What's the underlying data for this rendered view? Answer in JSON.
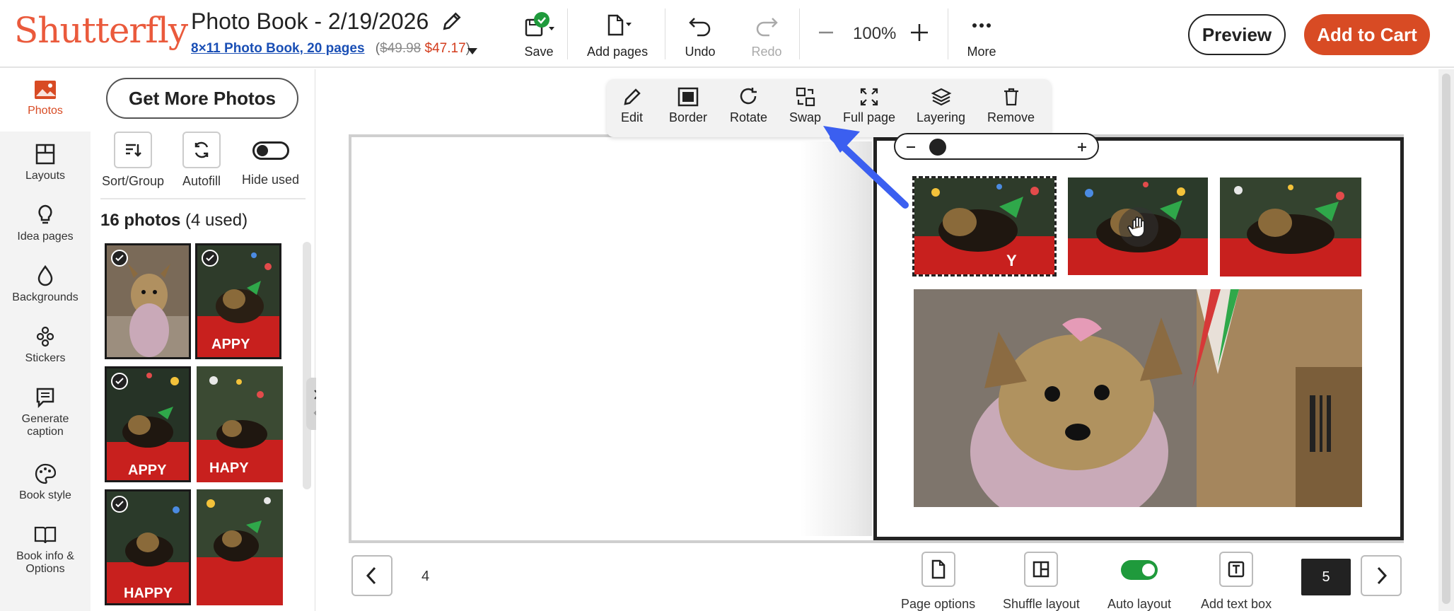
{
  "brand": {
    "logo": "Shutterfly"
  },
  "project": {
    "title": "Photo Book - 2/19/2026",
    "product_link": "8×11 Photo Book, 20 pages",
    "paren_open": "(",
    "price_old": "$49.98",
    "price_new": "$47.17",
    "paren_close": ")"
  },
  "toolbar": {
    "save": "Save",
    "add_pages": "Add pages",
    "undo": "Undo",
    "redo": "Redo",
    "zoom": "100%",
    "more": "More",
    "preview": "Preview",
    "add_to_cart": "Add to Cart"
  },
  "leftnav": {
    "photos": "Photos",
    "layouts": "Layouts",
    "idea_pages": "Idea pages",
    "backgrounds": "Backgrounds",
    "stickers": "Stickers",
    "generate_caption_1": "Generate",
    "generate_caption_2": "caption",
    "book_style": "Book style",
    "book_info_1": "Book info &",
    "book_info_2": "Options"
  },
  "photo_panel": {
    "get_more": "Get More Photos",
    "sort_group": "Sort/Group",
    "autofill": "Autofill",
    "hide_used": "Hide used",
    "count": "16 photos",
    "used": "(4 used)"
  },
  "float_toolbar": {
    "edit": "Edit",
    "border": "Border",
    "rotate": "Rotate",
    "swap": "Swap",
    "full_page": "Full page",
    "layering": "Layering",
    "remove": "Remove"
  },
  "bottom": {
    "left_page_number": "4",
    "page_options": "Page options",
    "shuffle_layout": "Shuffle layout",
    "auto_layout": "Auto layout",
    "add_text_box": "Add text box",
    "current_page": "5"
  },
  "colors": {
    "brand": "#ea5a3c",
    "cart": "#d84b24",
    "link": "#1a4fb5",
    "toggle_on": "#1f9a3c",
    "pointer_arrow": "#3b5ff0"
  }
}
